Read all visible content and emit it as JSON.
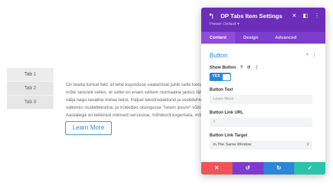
{
  "preview": {
    "tabs": [
      {
        "label": "Tab 1",
        "active": true
      },
      {
        "label": "Tab 2",
        "active": false
      },
      {
        "label": "Tab 3",
        "active": false
      }
    ],
    "content_lines": [
      "On teada-tuntud fakt, et lehe kujunduse vaatamisel juhib selle loeta",
      "mõte seisneb selles, et sellel on enam-vähem normaalne jaotus täh",
      "välja nagu tavaline loetav tekst. Paljud tekstiredaktorid ja veebilehte",
      "valkimisi mudeltekstina, ja trükkides otsingusse \"lorem ipsum\" võib",
      "Aastatega on tekkinud mitmeid versioone, mõnikord kogemata, mõni"
    ],
    "button_label": "Learn More"
  },
  "panel": {
    "title": "DP Tabs Item Settings",
    "preset": "Preset: Default ▾",
    "tabs": [
      "Content",
      "Design",
      "Advanced"
    ],
    "section_title": "Button",
    "show_button_label": "Show Button",
    "toggle_value": "YES",
    "button_text_label": "Button Text",
    "button_text_placeholder": "Learn More",
    "button_link_url_label": "Button Link URL",
    "button_link_url_value": "#",
    "button_link_target_label": "Button Link Target",
    "button_link_target_value": "In The Same Window"
  },
  "icons": {
    "back": "back-arrow-icon",
    "close": "close-icon",
    "layout": "layout-icon",
    "more": "more-icon"
  },
  "colors": {
    "header": "#6c2eb9",
    "accent": "#2b87da",
    "cancel": "#ef5555",
    "undo": "#7e3bd0",
    "redo": "#2b87da",
    "save": "#29c4a9"
  }
}
